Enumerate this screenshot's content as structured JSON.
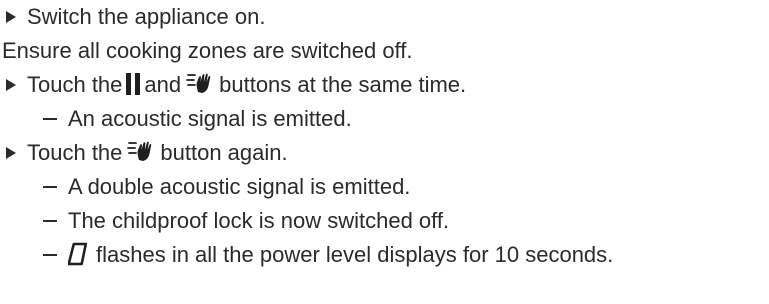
{
  "steps": {
    "s1": "Switch the appliance on.",
    "note": "Ensure all cooking zones are switched off.",
    "s2_pre": "Touch the",
    "s2_mid": "and",
    "s2_post": "buttons at the same time.",
    "s2_sub1": "An acoustic signal is emitted.",
    "s3_pre": "Touch the",
    "s3_post": "button again.",
    "s3_sub1": "A double acoustic signal is emitted.",
    "s3_sub2": "The childproof lock is now switched off.",
    "s3_sub3_post": "flashes in all the power level displays for 10 seconds."
  },
  "icons": {
    "pause": "pause-button-icon",
    "hand": "childproof-lock-hand-icon",
    "zero": "power-level-zero-icon"
  }
}
